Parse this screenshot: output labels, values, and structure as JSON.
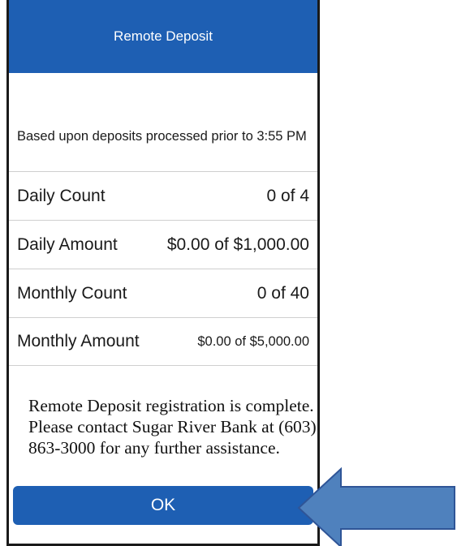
{
  "header": {
    "title": "Remote Deposit"
  },
  "limits": {
    "note": "Based upon deposits processed prior to 3:55 PM",
    "rows": [
      {
        "label": "Daily Count",
        "value": "0 of 4"
      },
      {
        "label": "Daily Amount",
        "value": "$0.00 of $1,000.00"
      },
      {
        "label": "Monthly Count",
        "value": "0 of 40"
      },
      {
        "label": "Monthly Amount",
        "value": "$0.00 of $5,000.00"
      }
    ]
  },
  "message": {
    "text": "Remote Deposit registration is complete. Please contact Sugar River Bank at (603) 863-3000 for any further assistance."
  },
  "footer": {
    "ok_label": "OK"
  },
  "annotation": {
    "arrow_icon": "left-arrow-icon",
    "fill_color": "#4f81bd",
    "stroke_color": "#2f5597"
  },
  "colors": {
    "header_bg": "#1e5fb3",
    "button_bg": "#1e5fb3",
    "text": "#1a1a1a",
    "divider": "#cfcfcf"
  }
}
